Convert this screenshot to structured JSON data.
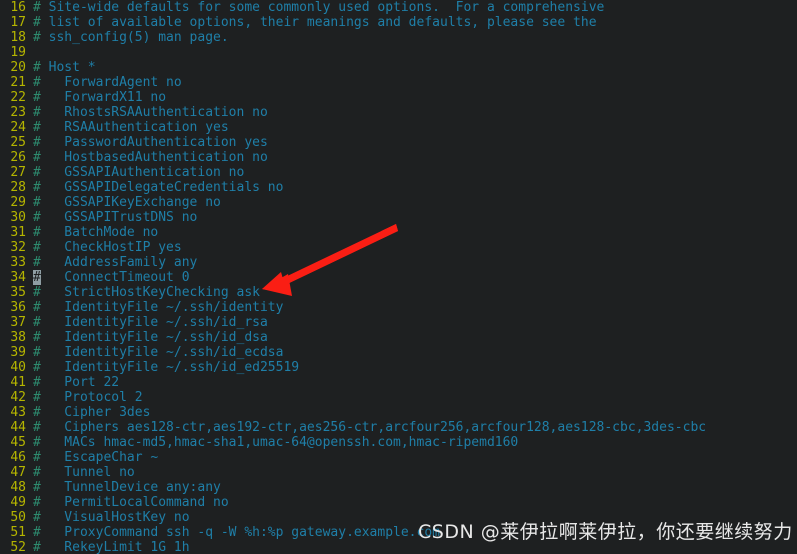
{
  "editor": {
    "name": "vim-ssh-config",
    "file_description": "ssh_config",
    "background": "#1e2021",
    "colors": {
      "line_number": "#b5b500",
      "comment_hash": "#2d8a6e",
      "comment_text": "#1f7fa8",
      "cursor_background": "#8f9ea4",
      "annotation_arrow": "#fa1e14"
    },
    "cursor": {
      "line": 34,
      "column": 1,
      "char": "#"
    },
    "lines": [
      {
        "num": "16",
        "hash": "#",
        "text": " Site-wide defaults for some commonly used options.  For a comprehensive"
      },
      {
        "num": "17",
        "hash": "#",
        "text": " list of available options, their meanings and defaults, please see the"
      },
      {
        "num": "18",
        "hash": "#",
        "text": " ssh_config(5) man page."
      },
      {
        "num": "19",
        "hash": "",
        "text": ""
      },
      {
        "num": "20",
        "hash": "#",
        "text": " Host *"
      },
      {
        "num": "21",
        "hash": "#",
        "text": "   ForwardAgent no"
      },
      {
        "num": "22",
        "hash": "#",
        "text": "   ForwardX11 no"
      },
      {
        "num": "23",
        "hash": "#",
        "text": "   RhostsRSAAuthentication no"
      },
      {
        "num": "24",
        "hash": "#",
        "text": "   RSAAuthentication yes"
      },
      {
        "num": "25",
        "hash": "#",
        "text": "   PasswordAuthentication yes"
      },
      {
        "num": "26",
        "hash": "#",
        "text": "   HostbasedAuthentication no"
      },
      {
        "num": "27",
        "hash": "#",
        "text": "   GSSAPIAuthentication no"
      },
      {
        "num": "28",
        "hash": "#",
        "text": "   GSSAPIDelegateCredentials no"
      },
      {
        "num": "29",
        "hash": "#",
        "text": "   GSSAPIKeyExchange no"
      },
      {
        "num": "30",
        "hash": "#",
        "text": "   GSSAPITrustDNS no"
      },
      {
        "num": "31",
        "hash": "#",
        "text": "   BatchMode no"
      },
      {
        "num": "32",
        "hash": "#",
        "text": "   CheckHostIP yes"
      },
      {
        "num": "33",
        "hash": "#",
        "text": "   AddressFamily any"
      },
      {
        "num": "34",
        "hash": "#",
        "text": "   ConnectTimeout 0",
        "cursor": true
      },
      {
        "num": "35",
        "hash": "#",
        "text": "   StrictHostKeyChecking ask"
      },
      {
        "num": "36",
        "hash": "#",
        "text": "   IdentityFile ~/.ssh/identity"
      },
      {
        "num": "37",
        "hash": "#",
        "text": "   IdentityFile ~/.ssh/id_rsa"
      },
      {
        "num": "38",
        "hash": "#",
        "text": "   IdentityFile ~/.ssh/id_dsa"
      },
      {
        "num": "39",
        "hash": "#",
        "text": "   IdentityFile ~/.ssh/id_ecdsa"
      },
      {
        "num": "40",
        "hash": "#",
        "text": "   IdentityFile ~/.ssh/id_ed25519"
      },
      {
        "num": "41",
        "hash": "#",
        "text": "   Port 22"
      },
      {
        "num": "42",
        "hash": "#",
        "text": "   Protocol 2"
      },
      {
        "num": "43",
        "hash": "#",
        "text": "   Cipher 3des"
      },
      {
        "num": "44",
        "hash": "#",
        "text": "   Ciphers aes128-ctr,aes192-ctr,aes256-ctr,arcfour256,arcfour128,aes128-cbc,3des-cbc"
      },
      {
        "num": "45",
        "hash": "#",
        "text": "   MACs hmac-md5,hmac-sha1,umac-64@openssh.com,hmac-ripemd160"
      },
      {
        "num": "46",
        "hash": "#",
        "text": "   EscapeChar ~"
      },
      {
        "num": "47",
        "hash": "#",
        "text": "   Tunnel no"
      },
      {
        "num": "48",
        "hash": "#",
        "text": "   TunnelDevice any:any"
      },
      {
        "num": "49",
        "hash": "#",
        "text": "   PermitLocalCommand no"
      },
      {
        "num": "50",
        "hash": "#",
        "text": "   VisualHostKey no"
      },
      {
        "num": "51",
        "hash": "#",
        "text": "   ProxyCommand ssh -q -W %h:%p gateway.example.com"
      },
      {
        "num": "52",
        "hash": "#",
        "text": "   RekeyLimit 1G 1h"
      }
    ]
  },
  "annotation": {
    "arrow_label": "red-arrow-pointing-to-strict-host-key-checking",
    "target_line": "35",
    "color": "#fa1e14"
  },
  "watermark": {
    "brand": "CSDN",
    "handle": "@莱伊拉啊莱伊拉",
    "message": "，你还要继续努力",
    "full": "CSDN @莱伊拉啊莱伊拉，你还要继续努力"
  }
}
